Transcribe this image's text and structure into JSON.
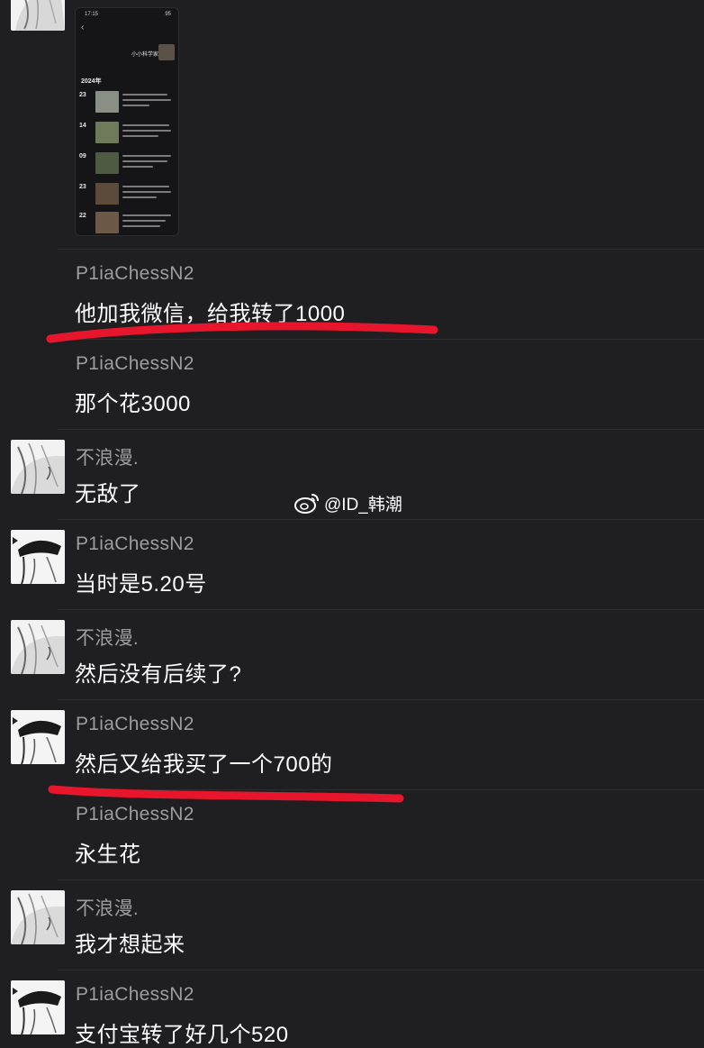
{
  "watermark": {
    "text": "@ID_韩潮",
    "icon": "weibo-icon"
  },
  "shared_screenshot": {
    "time": "17:15",
    "battery": "95",
    "profile_name": "小小科学家",
    "year": "2024年",
    "entries": [
      {
        "day": "23"
      },
      {
        "day": "14"
      },
      {
        "day": "09"
      },
      {
        "day": "23"
      },
      {
        "day": "22"
      }
    ]
  },
  "messages": [
    {
      "sender": "P1iaChessN2",
      "text": "他加我微信，给我转了1000"
    },
    {
      "sender": "P1iaChessN2",
      "text": "那个花3000"
    },
    {
      "sender": "不浪漫.",
      "text": "无敌了"
    },
    {
      "sender": "P1iaChessN2",
      "text": "当时是5.20号"
    },
    {
      "sender": "不浪漫.",
      "text": "然后没有后续了?"
    },
    {
      "sender": "P1iaChessN2",
      "text": "然后又给我买了一个700的"
    },
    {
      "sender": "P1iaChessN2",
      "text": "永生花"
    },
    {
      "sender": "不浪漫.",
      "text": "我才想起来"
    },
    {
      "sender": "P1iaChessN2",
      "text": "支付宝转了好几个520"
    }
  ],
  "colors": {
    "background": "#1f1f21",
    "sender": "#9d9d9f",
    "text": "#ffffff",
    "highlight": "#e8162c"
  }
}
